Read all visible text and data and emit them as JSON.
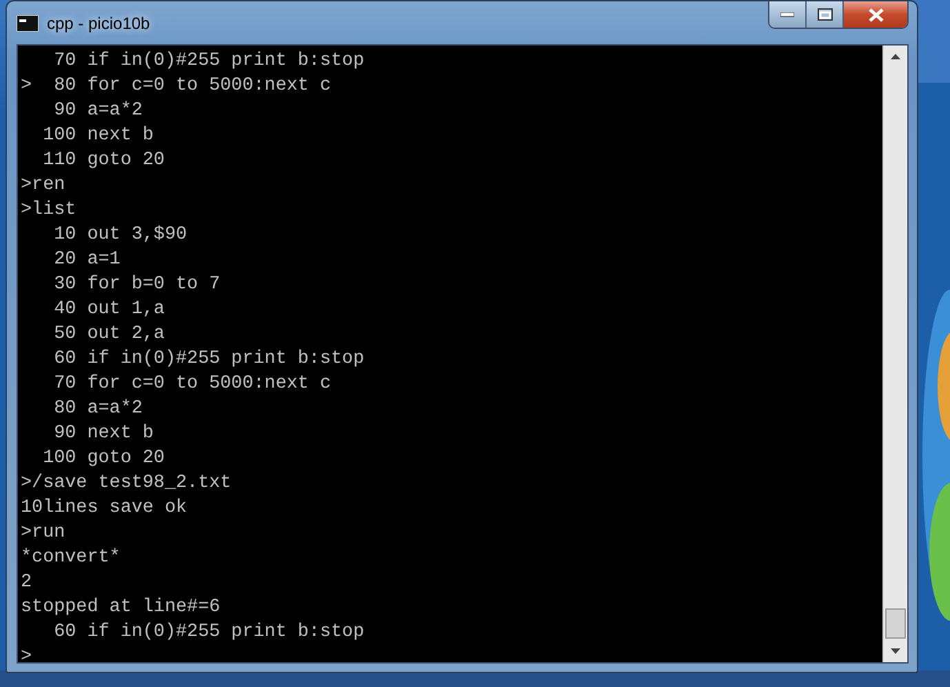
{
  "window": {
    "title": "cpp - picio10b"
  },
  "console": {
    "lines": [
      "   70 if in(0)#255 print b:stop",
      ">  80 for c=0 to 5000:next c",
      "   90 a=a*2",
      "  100 next b",
      "  110 goto 20",
      ">ren",
      ">list",
      "   10 out 3,$90",
      "   20 a=1",
      "   30 for b=0 to 7",
      "   40 out 1,a",
      "   50 out 2,a",
      "   60 if in(0)#255 print b:stop",
      "   70 for c=0 to 5000:next c",
      "   80 a=a*2",
      "   90 next b",
      "  100 goto 20",
      ">/save test98_2.txt",
      "10lines save ok",
      ">run",
      "*convert*",
      "2",
      "stopped at line#=6",
      "   60 if in(0)#255 print b:stop",
      ">"
    ]
  }
}
